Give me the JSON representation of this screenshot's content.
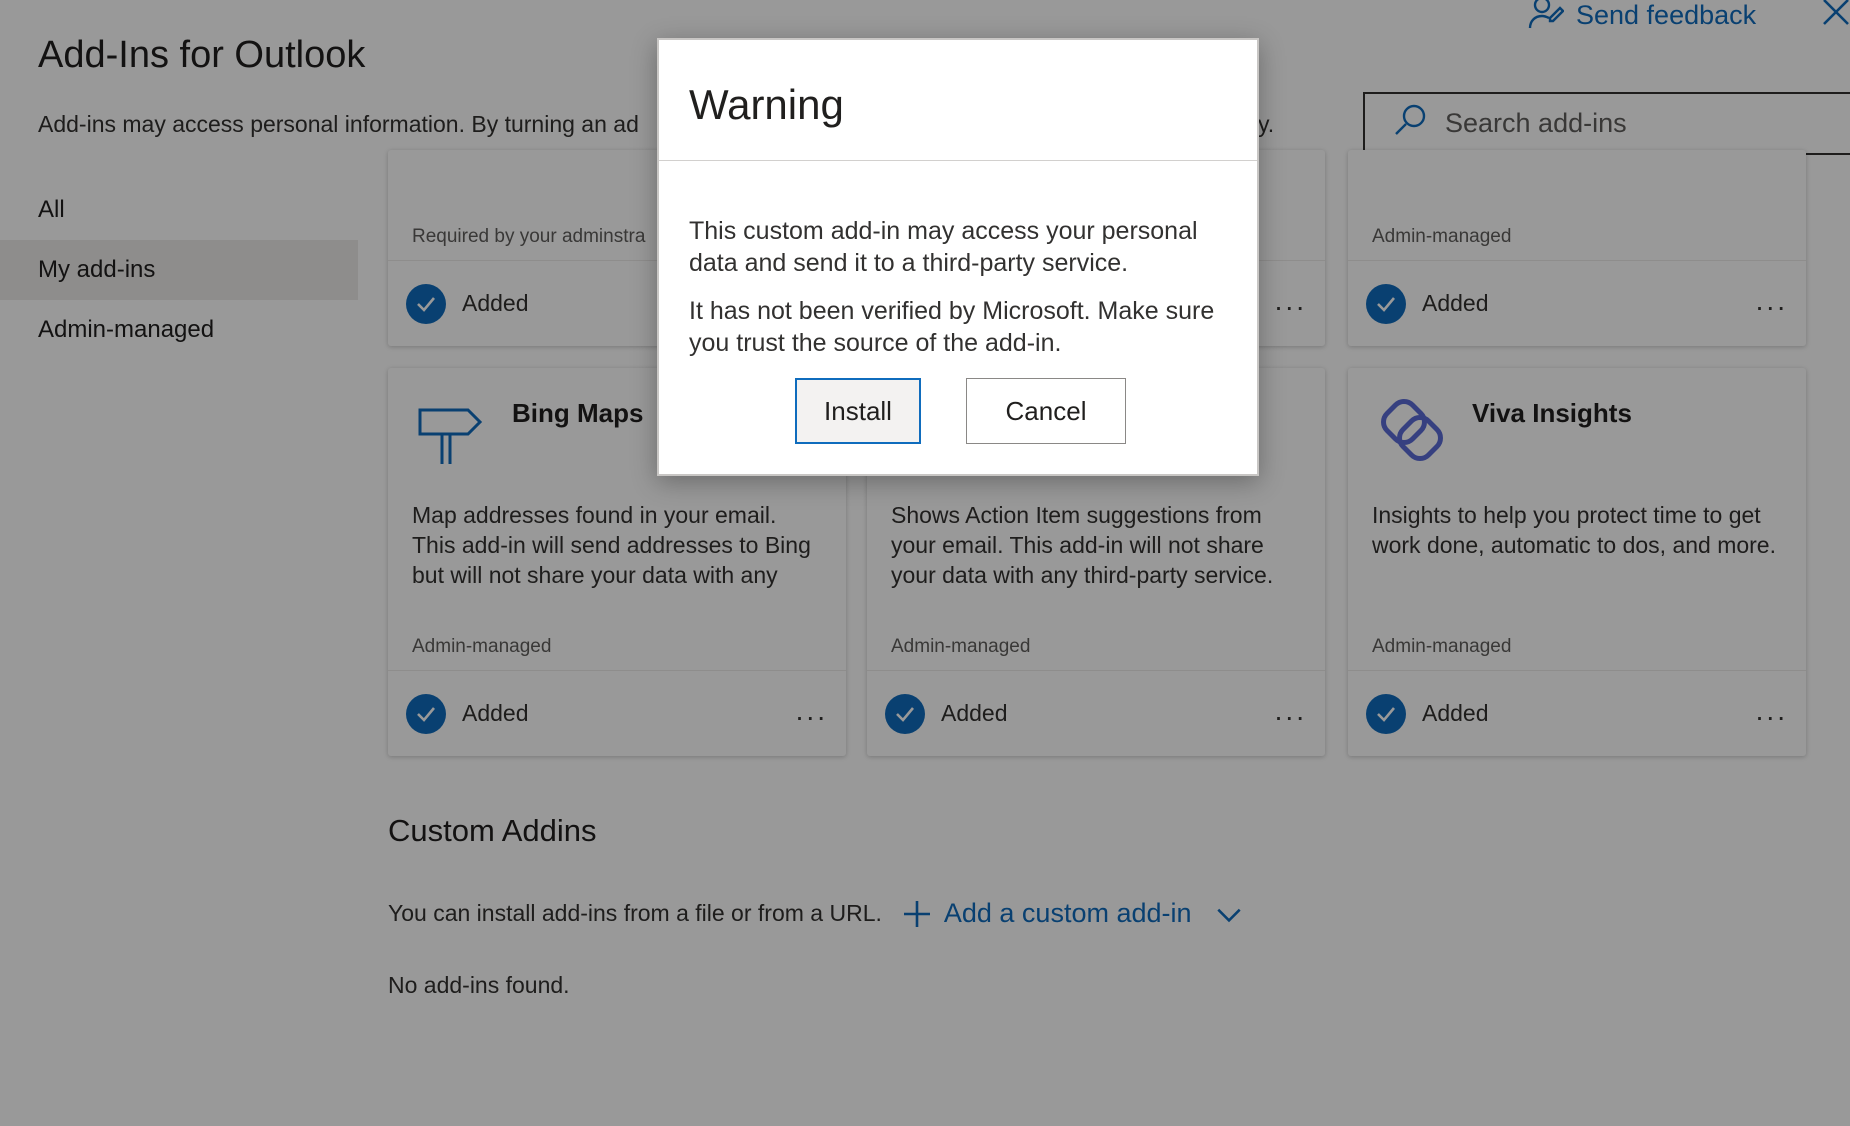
{
  "header": {
    "title": "Add-Ins for Outlook",
    "description": "Add-ins may access personal information. By turning an ad",
    "description_tail": "y.",
    "send_feedback": "Send feedback",
    "search_placeholder": "Search add-ins"
  },
  "nav": {
    "items": [
      {
        "label": "All"
      },
      {
        "label": "My add-ins",
        "selected": true
      },
      {
        "label": "Admin-managed"
      }
    ]
  },
  "top_cards": [
    {
      "tag": "Required by your adminstra",
      "status": "Added"
    },
    {
      "tag": "",
      "status": ""
    },
    {
      "tag": "Admin-managed",
      "status": "Added"
    }
  ],
  "cards": [
    {
      "name": "Bing Maps",
      "icon": "signpost-icon",
      "description": "Map addresses found in your email. This add-in will send addresses to Bing but will not share your data with any",
      "tag": "Admin-managed",
      "status": "Added"
    },
    {
      "name": "",
      "icon": "",
      "description": "Shows Action Item suggestions from your email. This add-in will not share your data with any third-party service.",
      "tag": "Admin-managed",
      "status": "Added"
    },
    {
      "name": "Viva Insights",
      "icon": "viva-insights-icon",
      "description": "Insights to help you protect time to get work done, automatic to dos, and more.",
      "tag": "Admin-managed",
      "status": "Added"
    }
  ],
  "custom": {
    "section_title": "Custom Addins",
    "install_text": "You can install add-ins from a file or from a URL.",
    "add_link": "Add a custom add-in",
    "empty_text": "No add-ins found."
  },
  "dialog": {
    "title": "Warning",
    "paragraph1": "This custom add-in may access your personal data and send it to a third-party service.",
    "paragraph2": "It has not been verified by Microsoft. Make sure you trust the source of the add-in.",
    "install_label": "Install",
    "cancel_label": "Cancel"
  },
  "colors": {
    "accent": "#0f6cbd",
    "overlay": "rgba(0,0,0,0.40)"
  }
}
